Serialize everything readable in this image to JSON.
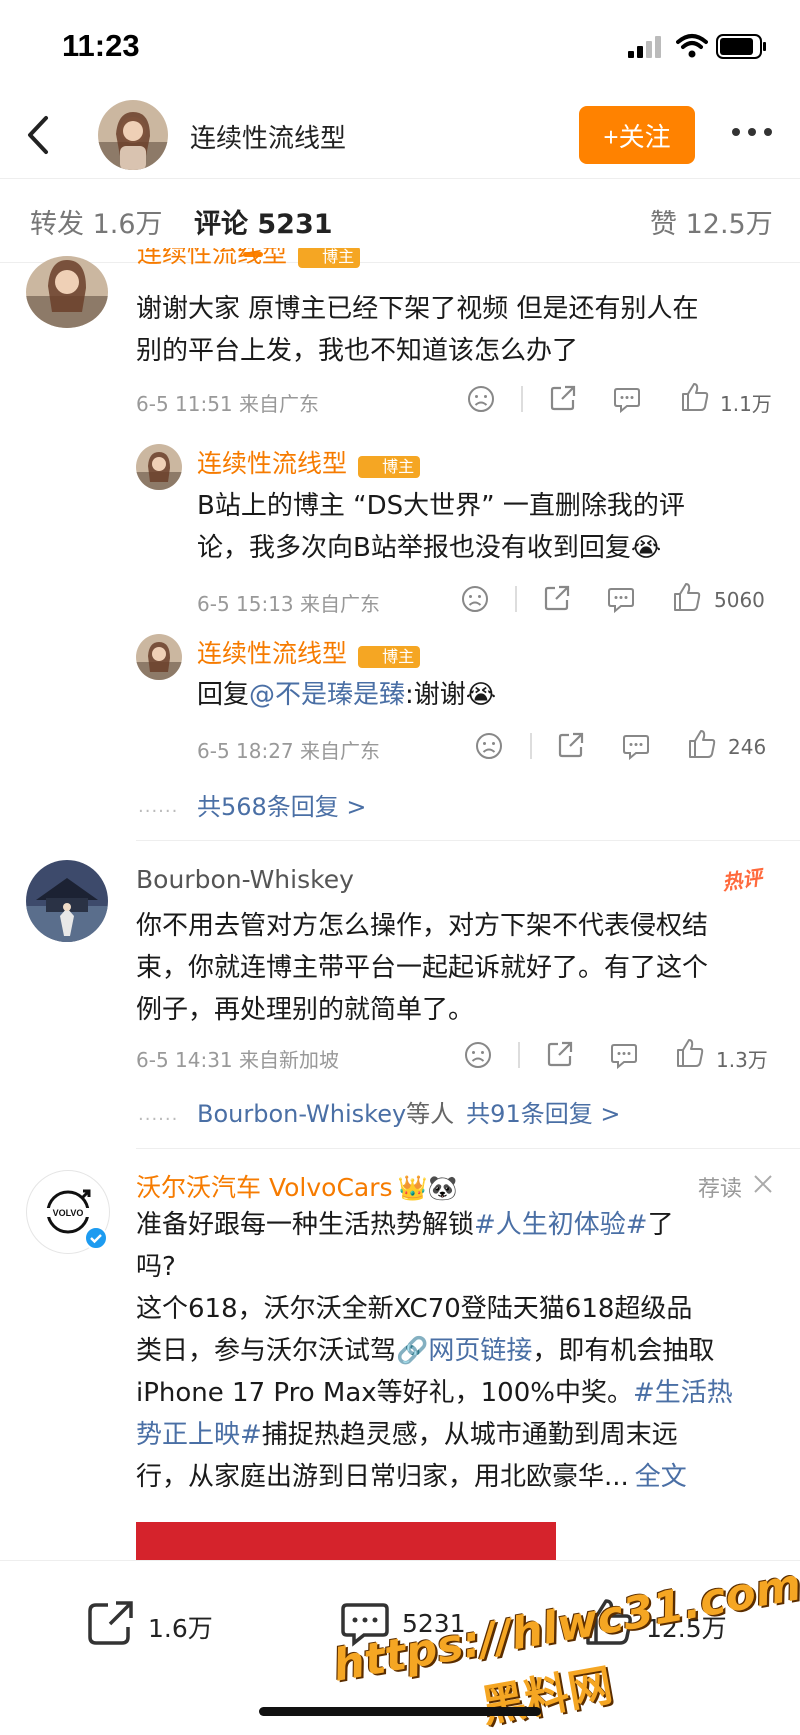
{
  "status_bar": {
    "time": "11:23"
  },
  "header": {
    "title": "连续性流线型",
    "follow_label": "+关注"
  },
  "tabs": [
    {
      "label": "转发 1.6万"
    },
    {
      "label": "评论 5231"
    },
    {
      "label": "赞 12.5万"
    }
  ],
  "comments": [
    {
      "user": "连续性流线型",
      "badge": "博主",
      "text_lines": [
        "谢谢大家 原博主已经下架了视频 但是还有别人在",
        "别的平台上发，我也不知道该怎么办了"
      ],
      "meta": "6-5 11:51 来自广东",
      "likes": "1.1万",
      "replies": [
        {
          "user": "连续性流线型",
          "badge": "博主",
          "text_lines": [
            "B站上的博主 “DS大世界” 一直删除我的评",
            "论，我多次向B站举报也没有收到回复😭"
          ],
          "meta": "6-5 15:13 来自广东",
          "likes": "5060"
        },
        {
          "user": "连续性流线型",
          "badge": "博主",
          "reply_prefix": "回复",
          "mention": "@不是瑧是臻",
          "text_after": ":谢谢😭",
          "meta": "6-5 18:27 来自广东",
          "likes": "246"
        }
      ],
      "more_replies": "共568条回复 >"
    },
    {
      "user": "Bourbon-Whiskey",
      "hot_label": "热评",
      "text_lines": [
        "你不用去管对方怎么操作，对方下架不代表侵权结",
        "束，你就连博主带平台一起起诉就好了。有了这个",
        "例子，再处理别的就简单了。"
      ],
      "meta": "6-5 14:31 来自新加坡",
      "likes": "1.3万",
      "more_replies_user": "Bourbon-Whiskey",
      "more_replies_mid": "等人",
      "more_replies": "共91条回复 >"
    }
  ],
  "ad": {
    "user": "沃尔沃汽车 VolvoCars",
    "tag": "荐读",
    "emoji": "👑🐼",
    "logo_text": "VOLVO",
    "line1_a": "准备好跟每一种生活热势解锁",
    "line1_tag": "#人生初体验#",
    "line1_b": "了",
    "line2": "吗?",
    "line3": "这个618，沃尔沃全新XC70登陆天猫618超级品",
    "line4_a": "类日，参与沃尔沃试驾",
    "line4_link": "🔗网页链接",
    "line4_b": "，即有机会抽取",
    "line5_a": "iPhone 17 Pro Max等好礼，100%中奖。",
    "line5_tag": "#生活热",
    "line6_tag": "势正上映#",
    "line6_b": "捕捉热趋灵感，从城市通勤到周末远",
    "line7_a": "行，从家庭出游到日常归家，用北欧豪华...",
    "line7_more": "全文"
  },
  "bottom_bar": {
    "repost": "1.6万",
    "comment": "5231",
    "like": "12.5万"
  },
  "watermark": {
    "line1": "https://hlwc31.com",
    "line2": "黑料网"
  },
  "colors": {
    "accent": "#ff8200",
    "username": "#f67b00",
    "link": "#4a6fa5"
  }
}
